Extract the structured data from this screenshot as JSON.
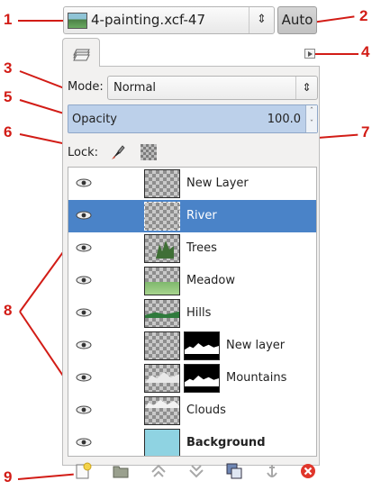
{
  "image_menu": {
    "name": "4-painting.xcf-47",
    "auto_label": "Auto"
  },
  "mode": {
    "label": "Mode:",
    "value": "Normal"
  },
  "opacity": {
    "label": "Opacity",
    "value": "100.0"
  },
  "lock": {
    "label": "Lock:"
  },
  "layers": [
    {
      "name": "New Layer",
      "selected": false,
      "bold": false,
      "mask": false
    },
    {
      "name": "River",
      "selected": true,
      "bold": false,
      "mask": false
    },
    {
      "name": "Trees",
      "selected": false,
      "bold": false,
      "mask": false
    },
    {
      "name": "Meadow",
      "selected": false,
      "bold": false,
      "mask": false
    },
    {
      "name": "Hills",
      "selected": false,
      "bold": false,
      "mask": false
    },
    {
      "name": "New layer",
      "selected": false,
      "bold": false,
      "mask": true
    },
    {
      "name": "Mountains",
      "selected": false,
      "bold": false,
      "mask": true
    },
    {
      "name": "Clouds",
      "selected": false,
      "bold": false,
      "mask": false
    },
    {
      "name": "Background",
      "selected": false,
      "bold": true,
      "mask": false
    }
  ],
  "callouts": [
    "1",
    "2",
    "3",
    "4",
    "5",
    "6",
    "7",
    "8",
    "9"
  ],
  "colors": {
    "callout": "#d21c16",
    "selection": "#4a83c8",
    "opacity_bar": "#bcd0ea"
  },
  "bottom_buttons": [
    "new-layer-icon",
    "new-layer-group-icon",
    "raise-layer-icon",
    "lower-layer-icon",
    "duplicate-layer-icon",
    "anchor-layer-icon",
    "delete-layer-icon"
  ]
}
